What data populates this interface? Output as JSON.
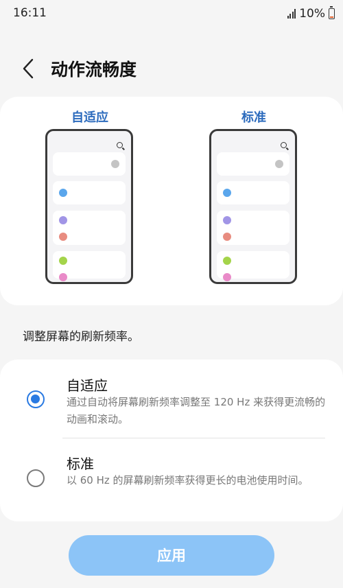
{
  "status_bar": {
    "time": "16:11",
    "battery_percent": "10%"
  },
  "header": {
    "title": "动作流畅度",
    "back_icon": "chevron-left-icon"
  },
  "preview": {
    "adaptive_label": "自适应",
    "standard_label": "标准",
    "dot_colors": {
      "gray": "#c4c4c4",
      "blue": "#5aa6ec",
      "purple": "#a195e6",
      "salmon": "#e88c80",
      "green": "#a4d44a",
      "pink": "#e98ac8"
    }
  },
  "description": "调整屏幕的刷新频率。",
  "options": [
    {
      "title": "自适应",
      "description": "通过自动将屏幕刷新频率调整至 120 Hz 来获得更流畅的动画和滚动。",
      "selected": true
    },
    {
      "title": "标准",
      "description": "以 60 Hz 的屏幕刷新频率获得更长的电池使用时间。",
      "selected": false
    }
  ],
  "apply_button": {
    "label": "应用",
    "enabled": false
  },
  "colors": {
    "accent": "#2a7ae2",
    "preview_label": "#2c6bbd",
    "apply_button_disabled": "#8cc4f7"
  }
}
